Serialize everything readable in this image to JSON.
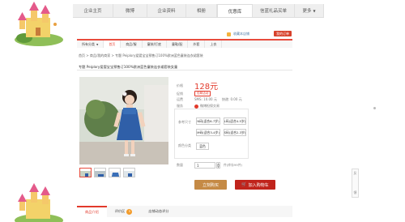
{
  "top_tabs": [
    {
      "label": "企业主页"
    },
    {
      "label": "微博"
    },
    {
      "label": "企业资料"
    },
    {
      "label": "相册"
    },
    {
      "label": "优惠库"
    },
    {
      "label": "信蓝礼品买单"
    },
    {
      "label": "更多"
    }
  ],
  "banner": {
    "favorite": "收藏本店铺",
    "my_order": "我的订单"
  },
  "cat_nav": [
    {
      "label": "所有分类"
    },
    {
      "label": "首页"
    },
    {
      "label": "商品/服"
    },
    {
      "label": "童装/打底"
    },
    {
      "label": "童鞋/配"
    },
    {
      "label": "外套"
    },
    {
      "label": "上衣"
    }
  ],
  "breadcrumb": "首页 > 商品/我的商家 > 专题 Peiplory爱婴宝宝预售订100%欧洲蓝色童装连衣裙套装",
  "product_title": "专题 Peiplory爱婴宝宝预售订100%欧洲蓝色童装连衣裙套装女童",
  "info": {
    "price_label": "价格",
    "price": "128元",
    "promo_label": "促销",
    "promo_badge": "包邮活动",
    "delivery_label": "运费",
    "delivery_value": "SMS: 10.00 元",
    "delivery_extra": "快递: 0.00 元",
    "guarantee_label": "服务",
    "guarantee": "微博担保交易"
  },
  "spec": {
    "size_label": "参考尺寸",
    "sizes": [
      "N码(适合6-7岁)",
      "L码(适合4-5岁)",
      "M码(适合3-4岁)",
      "S码(适合2-3岁)"
    ],
    "color_label": "颜色分类",
    "colors": [
      "蓝色"
    ]
  },
  "quantity": {
    "label": "数量",
    "value": "1",
    "note": "件(库存99件)"
  },
  "buttons": {
    "buy": "立刻购买",
    "cart": "加入购物车"
  },
  "bottom_tabs": [
    {
      "label": "商品介绍"
    },
    {
      "label": "评价区",
      "count": "5"
    },
    {
      "label": "店铺动态评分"
    }
  ],
  "side_float": [
    "反",
    "馈"
  ]
}
